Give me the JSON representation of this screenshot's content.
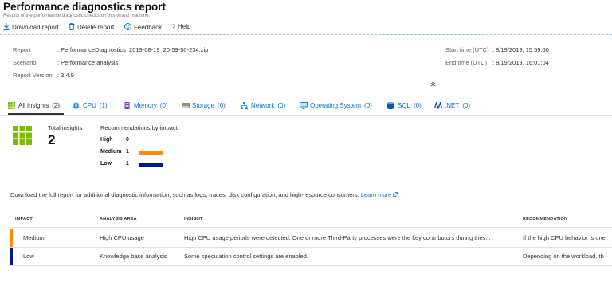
{
  "header": {
    "title": "Performance diagnostics report",
    "subtitle": "Results of the performance diagnostic checks on this virtual machine."
  },
  "toolbar": {
    "download_label": "Download report",
    "delete_label": "Delete report",
    "feedback_label": "Feedback",
    "help_label": "Help"
  },
  "meta": {
    "report_label": "Report",
    "report_value": "PerformanceDiagnostics_2019-08-19_20-59-50-234.zip",
    "scenario_label": "Scenario",
    "scenario_value": "Performance analysis",
    "version_label": "Report Version",
    "version_value": "3.4.9",
    "start_label": "Start time (UTC)",
    "start_value": "8/19/2019, 15:59:50",
    "end_label": "End time (UTC)",
    "end_value": "8/19/2019, 16:01:04"
  },
  "tabs": [
    {
      "label": "All insights",
      "count": "(2)"
    },
    {
      "label": "CPU",
      "count": "(1)"
    },
    {
      "label": "Memory",
      "count": "(0)"
    },
    {
      "label": "Storage",
      "count": "(0)"
    },
    {
      "label": "Network",
      "count": "(0)"
    },
    {
      "label": "Operating System",
      "count": "(0)"
    },
    {
      "label": "SQL",
      "count": "(0)"
    },
    {
      "label": ".NET",
      "count": "(0)"
    }
  ],
  "summary": {
    "total_label": "Total insights",
    "total_value": "2",
    "impact_title": "Recommendations by impact",
    "impacts": [
      {
        "label": "High",
        "count": "0",
        "fraction": 0,
        "color": "#d13438"
      },
      {
        "label": "Medium",
        "count": "1",
        "fraction": 1,
        "color": "#ff8c00"
      },
      {
        "label": "Low",
        "count": "1",
        "fraction": 1,
        "color": "#00188f"
      }
    ]
  },
  "download_note": {
    "text": "Download the full report for additional diagnostic information, such as logs, traces, disk configuration, and high-resource consumers.",
    "link": "Learn more"
  },
  "table": {
    "headers": [
      "IMPACT",
      "ANALYSIS AREA",
      "INSIGHT",
      "RECOMMENDATION"
    ],
    "rows": [
      {
        "impact": "Medium",
        "area": "High CPU usage",
        "insight": "High CPU usage periods were detected. One or more Third-Party processes were the key contributors during thes...",
        "recommendation": "If the high CPU behavior is une",
        "color": "#ff8c00"
      },
      {
        "impact": "Low",
        "area": "Knowledge base analysis",
        "insight": "Some speculation control settings are enabled.",
        "recommendation": "Depending on the workload, th",
        "color": "#00188f"
      }
    ]
  },
  "colors": {
    "accent": "#0078d4",
    "link": "#0b6fd0",
    "insight_tile": "#7fba00"
  },
  "icons": {
    "download": "download-icon",
    "delete": "trash-icon",
    "feedback": "smiley-icon",
    "help": "question-icon",
    "collapse": "double-chevron-up-icon"
  }
}
